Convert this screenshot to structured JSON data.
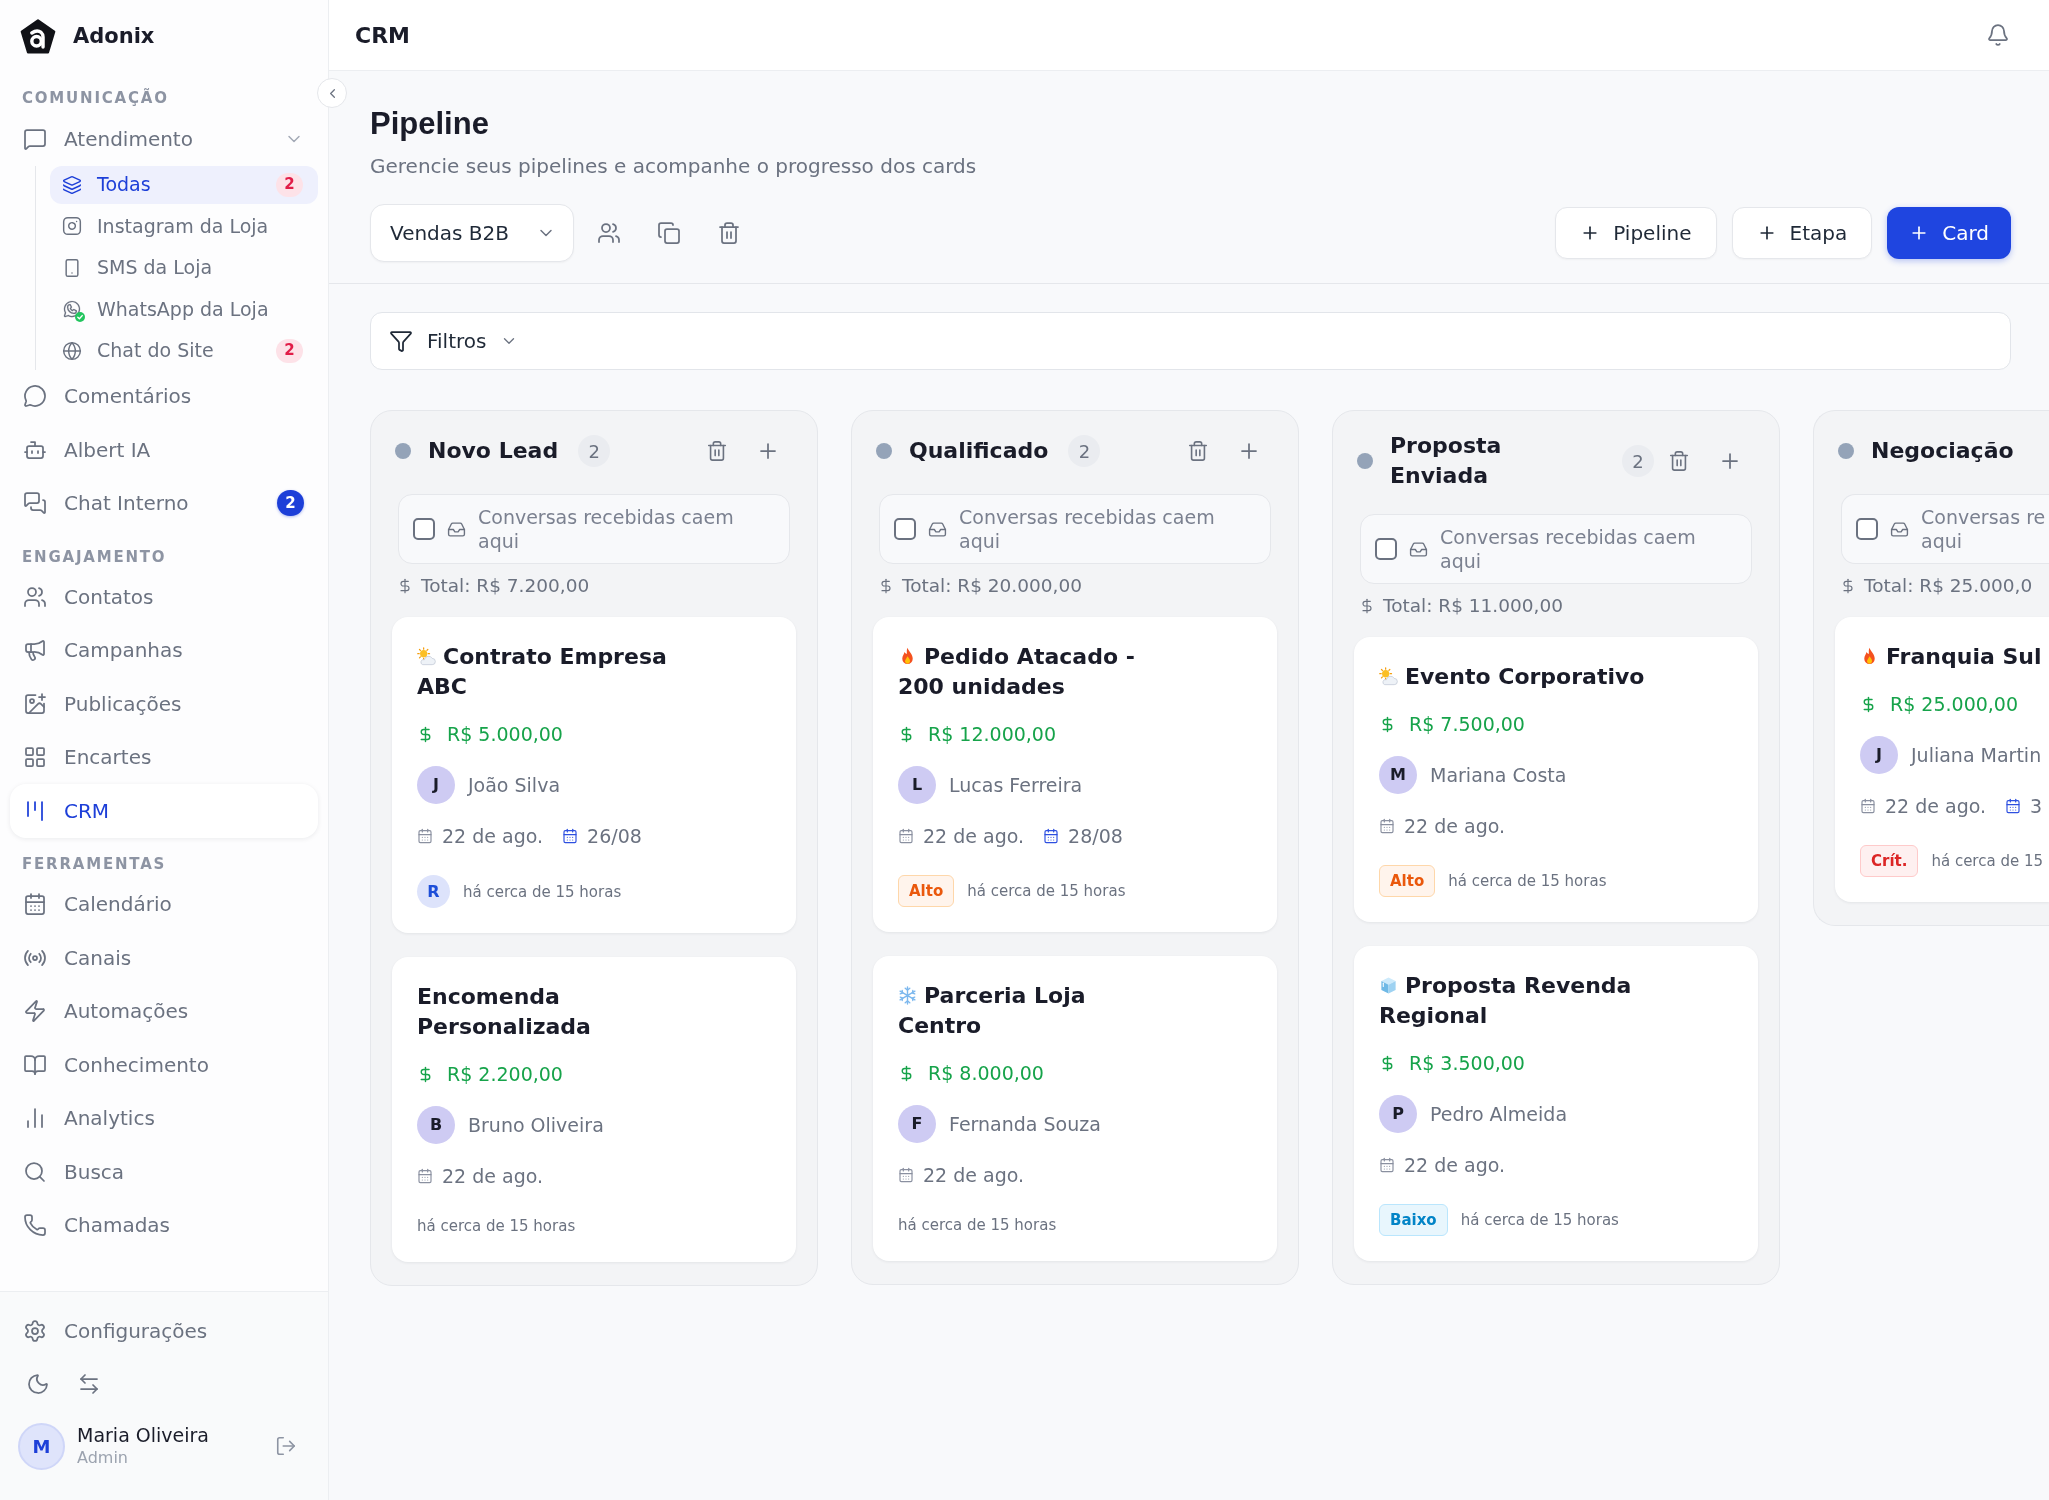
{
  "app": {
    "name": "Adonix"
  },
  "sidebar": {
    "sections": [
      {
        "label": "COMUNICAÇÃO",
        "items": [
          {
            "label": "Atendimento",
            "selected": false,
            "expanded": true,
            "children": [
              {
                "label": "Todas",
                "selected": true,
                "connected": false,
                "badge": "2"
              },
              {
                "label": "Instagram da Loja",
                "selected": false,
                "connected": false
              },
              {
                "label": "SMS da Loja",
                "selected": false,
                "connected": false
              },
              {
                "label": "WhatsApp da Loja",
                "selected": false,
                "connected": true
              },
              {
                "label": "Chat do Site",
                "selected": false,
                "connected": false,
                "badge": "2"
              }
            ]
          },
          {
            "label": "Comentários",
            "selected": false
          },
          {
            "label": "Albert IA",
            "selected": false
          },
          {
            "label": "Chat Interno",
            "selected": false,
            "badge": "2"
          }
        ]
      },
      {
        "label": "ENGAJAMENTO",
        "items": [
          {
            "label": "Contatos",
            "selected": false
          },
          {
            "label": "Campanhas",
            "selected": false
          },
          {
            "label": "Publicações",
            "selected": false
          },
          {
            "label": "Encartes",
            "selected": false
          },
          {
            "label": "CRM",
            "selected": true
          }
        ]
      },
      {
        "label": "FERRAMENTAS",
        "items": [
          {
            "label": "Calendário",
            "selected": false
          },
          {
            "label": "Canais",
            "selected": false
          },
          {
            "label": "Automações",
            "selected": false
          },
          {
            "label": "Conhecimento",
            "selected": false
          },
          {
            "label": "Analytics",
            "selected": false
          },
          {
            "label": "Busca",
            "selected": false
          },
          {
            "label": "Chamadas",
            "selected": false
          }
        ]
      }
    ],
    "footer": {
      "settings": "Configurações",
      "user": {
        "initial": "M",
        "name": "Maria Oliveira",
        "role": "Admin"
      }
    }
  },
  "header": {
    "title": "CRM"
  },
  "page": {
    "title": "Pipeline",
    "subtitle": "Gerencie seus pipelines e acompanhe o progresso dos cards",
    "pipeline_select": {
      "value": "Vendas B2B"
    },
    "actions": [
      {
        "label": "Pipeline",
        "kind": "secondary"
      },
      {
        "label": "Etapa",
        "kind": "secondary"
      },
      {
        "label": "Card",
        "kind": "primary"
      }
    ]
  },
  "filters": {
    "label": "Filtros"
  },
  "board": {
    "columns": [
      {
        "title": "Novo Lead",
        "count": "2",
        "clipped": false,
        "drop_zone": {
          "checked": false,
          "text": "Conversas recebidas caem aqui"
        },
        "total": "Total: R$ 7.200,00",
        "cards": [
          {
            "kind": "warm",
            "title": "Contrato Empresa ABC",
            "amount": "R$ 5.000,00",
            "contact": {
              "initial": "J",
              "name": "João Silva"
            },
            "created": "22 de ago.",
            "due": "26/08",
            "assignee": "R",
            "updated": "há cerca de 15 horas"
          },
          {
            "kind": "plain",
            "title": "Encomenda Personalizada",
            "amount": "R$ 2.200,00",
            "contact": {
              "initial": "B",
              "name": "Bruno Oliveira"
            },
            "created": "22 de ago.",
            "updated": "há cerca de 15 horas"
          }
        ]
      },
      {
        "title": "Qualificado",
        "count": "2",
        "clipped": false,
        "drop_zone": {
          "checked": false,
          "text": "Conversas recebidas caem aqui"
        },
        "total": "Total: R$ 20.000,00",
        "cards": [
          {
            "kind": "hot",
            "title": "Pedido Atacado - 200 unidades",
            "amount": "R$ 12.000,00",
            "contact": {
              "initial": "L",
              "name": "Lucas Ferreira"
            },
            "created": "22 de ago.",
            "due": "28/08",
            "priority": {
              "label": "Alto",
              "kind": "high"
            },
            "updated": "há cerca de 15 horas"
          },
          {
            "kind": "cold",
            "title": "Parceria Loja Centro",
            "amount": "R$ 8.000,00",
            "contact": {
              "initial": "F",
              "name": "Fernanda Souza"
            },
            "created": "22 de ago.",
            "updated": "há cerca de 15 horas"
          }
        ]
      },
      {
        "title": "Proposta Enviada",
        "count": "2",
        "clipped": false,
        "drop_zone": {
          "checked": false,
          "text": "Conversas recebidas caem aqui"
        },
        "total": "Total: R$ 11.000,00",
        "cards": [
          {
            "kind": "warm",
            "title": "Evento Corporativo",
            "amount": "R$ 7.500,00",
            "contact": {
              "initial": "M",
              "name": "Mariana Costa"
            },
            "created": "22 de ago.",
            "priority": {
              "label": "Alto",
              "kind": "high"
            },
            "updated": "há cerca de 15 horas"
          },
          {
            "kind": "frozen",
            "title": "Proposta Revenda Regional",
            "amount": "R$ 3.500,00",
            "contact": {
              "initial": "P",
              "name": "Pedro Almeida"
            },
            "created": "22 de ago.",
            "priority": {
              "label": "Baixo",
              "kind": "low"
            },
            "updated": "há cerca de 15 horas"
          }
        ]
      },
      {
        "title": "Negociação",
        "clipped": true,
        "drop_zone": {
          "checked": false,
          "text": "Conversas re aqui"
        },
        "total": "Total: R$ 25.000,0",
        "cards": [
          {
            "kind": "hot",
            "title": "Franquia Sul",
            "amount": "R$ 25.000,00",
            "contact": {
              "initial": "J",
              "name": "Juliana Martin"
            },
            "created": "22 de ago.",
            "due": "3",
            "priority": {
              "label": "Crít.",
              "kind": "critical"
            },
            "updated": "há cerca de 15"
          }
        ]
      }
    ]
  }
}
